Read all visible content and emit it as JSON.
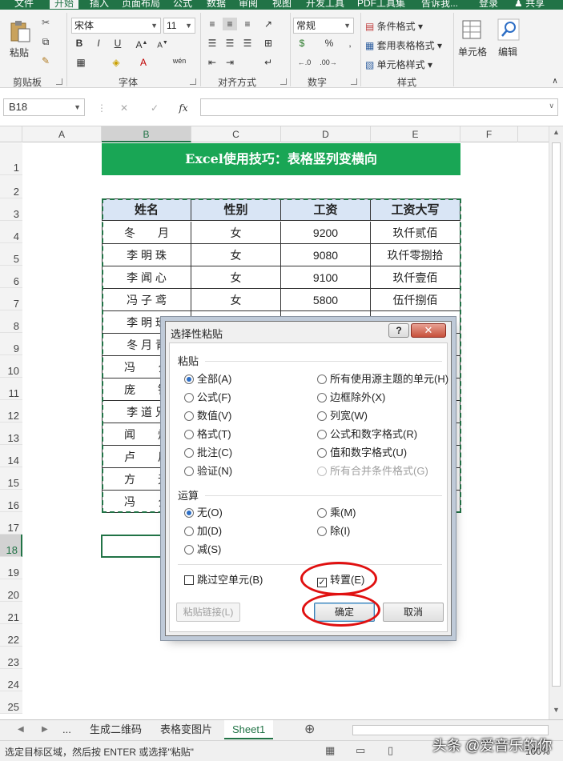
{
  "ribbon": {
    "tabs": [
      "文件",
      "开始",
      "插入",
      "页面布局",
      "公式",
      "数据",
      "审阅",
      "视图",
      "开发工具",
      "PDF工具集",
      "告诉我..."
    ],
    "active_tab": "开始",
    "login": "登录",
    "share": "共享",
    "clipboard": {
      "paste": "粘贴",
      "label": "剪贴板"
    },
    "font": {
      "name": "宋体",
      "size": "11",
      "label": "字体",
      "wen": "wén"
    },
    "alignment": {
      "label": "对齐方式"
    },
    "number": {
      "format": "常规",
      "label": "数字",
      "percent": "%"
    },
    "styles": {
      "conditional": "条件格式",
      "table": "套用表格格式",
      "cell": "单元格样式",
      "label": "样式"
    },
    "cells": {
      "label": "单元格"
    },
    "editing": {
      "label": "编辑"
    }
  },
  "formula_bar": {
    "name_box": "B18",
    "fx": "fx",
    "value": ""
  },
  "columns": [
    "A",
    "B",
    "C",
    "D",
    "E",
    "F"
  ],
  "selected_column": "B",
  "rows": [
    "1",
    "2",
    "3",
    "4",
    "5",
    "6",
    "7",
    "8",
    "9",
    "10",
    "11",
    "12",
    "13",
    "14",
    "15",
    "16",
    "17",
    "18",
    "19",
    "20",
    "21",
    "22",
    "23",
    "24",
    "25"
  ],
  "selected_row": "18",
  "banner": "Excel使用技巧：表格竖列变横向",
  "table": {
    "headers": [
      "姓名",
      "性别",
      "工资",
      "工资大写"
    ],
    "rows": [
      [
        "冬　　月",
        "女",
        "9200",
        "玖仟贰佰"
      ],
      [
        "李 明 珠",
        "女",
        "9080",
        "玖仟零捌拾"
      ],
      [
        "李 闻 心",
        "女",
        "9100",
        "玖仟壹佰"
      ],
      [
        "冯 子 鸢",
        "女",
        "5800",
        "伍仟捌佰"
      ],
      [
        "李 明 珠",
        "女",
        "6900",
        "陆仟玖佰"
      ],
      [
        "冬 月 青",
        "",
        "",
        ""
      ],
      [
        "冯　　夕",
        "",
        "",
        ""
      ],
      [
        "庞　　钰",
        "",
        "",
        ""
      ],
      [
        "李 道 兄",
        "",
        "",
        ""
      ],
      [
        "闻　　灿",
        "",
        "",
        ""
      ],
      [
        "卢　　川",
        "",
        "",
        ""
      ],
      [
        "方　　无",
        "",
        "",
        ""
      ],
      [
        "冯　　夕",
        "",
        "",
        ""
      ]
    ]
  },
  "sheet_tabs": [
    "...",
    "生成二维码",
    "表格变图片",
    "Sheet1"
  ],
  "active_sheet": "Sheet1",
  "status_text": "选定目标区域，然后按 ENTER 或选择\"粘贴\"",
  "zoom": "100%",
  "watermark": "头条 @爱音乐的你",
  "dialog": {
    "title": "选择性粘贴",
    "paste_section": "粘贴",
    "paste_left": [
      "全部(A)",
      "公式(F)",
      "数值(V)",
      "格式(T)",
      "批注(C)",
      "验证(N)"
    ],
    "paste_right": [
      "所有使用源主题的单元(H)",
      "边框除外(X)",
      "列宽(W)",
      "公式和数字格式(R)",
      "值和数字格式(U)",
      "所有合并条件格式(G)"
    ],
    "operation_section": "运算",
    "op_left": [
      "无(O)",
      "加(D)",
      "减(S)"
    ],
    "op_right": [
      "乘(M)",
      "除(I)"
    ],
    "skip_blanks": "跳过空单元(B)",
    "transpose": "转置(E)",
    "paste_link": "粘贴链接(L)",
    "ok": "确定",
    "cancel": "取消",
    "help": "?",
    "close": "✕"
  },
  "colors": {
    "excel_green": "#217346",
    "banner_green": "#19a655",
    "header_blue": "#d9e5f5",
    "highlight_red": "#e01010"
  }
}
